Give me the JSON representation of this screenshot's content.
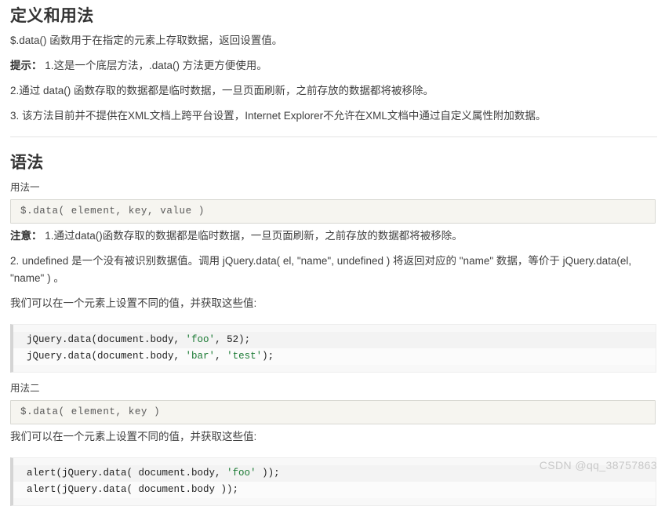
{
  "sections": [
    {
      "id": "definition",
      "title": "定义和用法",
      "paragraphs": [
        {
          "bold": "",
          "text": "$.data() 函数用于在指定的元素上存取数据，返回设置值。"
        },
        {
          "bold": "提示：",
          "text": " 1.这是一个底层方法，.data() 方法更方便使用。"
        },
        {
          "bold": "",
          "text": "2.通过 data() 函数存取的数据都是临时数据，一旦页面刷新，之前存放的数据都将被移除。"
        },
        {
          "bold": "",
          "text": "3. 该方法目前并不提供在XML文档上跨平台设置，Internet Explorer不允许在XML文档中通过自定义属性附加数据。"
        }
      ]
    },
    {
      "id": "syntax",
      "title": "语法",
      "usage_one_label": "用法一",
      "usage_one_signature": "$.data( element, key, value )",
      "paragraphs": [
        {
          "bold": "注意：",
          "text": " 1.通过data()函数存取的数据都是临时数据，一旦页面刷新，之前存放的数据都将被移除。"
        },
        {
          "bold": "",
          "text": "2. undefined 是一个没有被识别数据值。调用 jQuery.data( el, \"name\", undefined ) 将返回对应的 \"name\" 数据，等价于 jQuery.data(el, \"name\" ) 。"
        },
        {
          "bold": "",
          "text": "我们可以在一个元素上设置不同的值，并获取这些值:"
        }
      ],
      "code_block_one": [
        [
          {
            "t": "jQuery.data(document.body, ",
            "c": "plain"
          },
          {
            "t": "'foo'",
            "c": "str"
          },
          {
            "t": ", ",
            "c": "plain"
          },
          {
            "t": "52",
            "c": "num"
          },
          {
            "t": ");",
            "c": "plain"
          }
        ],
        [
          {
            "t": "jQuery.data(document.body, ",
            "c": "plain"
          },
          {
            "t": "'bar'",
            "c": "str"
          },
          {
            "t": ", ",
            "c": "plain"
          },
          {
            "t": "'test'",
            "c": "str"
          },
          {
            "t": ");",
            "c": "plain"
          }
        ]
      ],
      "usage_two_label": "用法二",
      "usage_two_signature": "$.data( element, key )",
      "usage_two_note": "我们可以在一个元素上设置不同的值，并获取这些值:",
      "code_block_two": [
        [
          {
            "t": "alert(jQuery.data( document.body, ",
            "c": "plain"
          },
          {
            "t": "'foo'",
            "c": "str"
          },
          {
            "t": " ));",
            "c": "plain"
          }
        ],
        [
          {
            "t": "alert(jQuery.data( document.body ));",
            "c": "plain"
          }
        ]
      ]
    }
  ],
  "watermark": "CSDN @qq_38757863",
  "colors": {
    "text": "#3f3f3f",
    "heading": "#333333",
    "string_literal": "#1a7a33",
    "code_background": "#f8f8f8",
    "syntax_background": "#f6f5f0",
    "divider": "#e3e3e3",
    "watermark": "#c9c9c9"
  }
}
